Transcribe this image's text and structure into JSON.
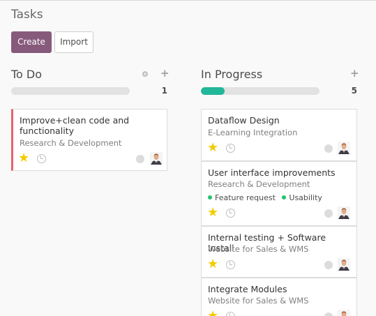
{
  "page": {
    "title": "Tasks"
  },
  "toolbar": {
    "create_label": "Create",
    "import_label": "Import"
  },
  "colors": {
    "accent": "#875a7b",
    "progress": "#21b799",
    "star": "#f3cc00",
    "tag_dot": "#21c56b",
    "priority_bar": "#e2646b"
  },
  "columns": [
    {
      "title": "To Do",
      "count": "1",
      "progress": 0,
      "icons": [
        "gear-icon",
        "plus-icon"
      ],
      "cards": [
        {
          "title": "Improve+clean code and functionality",
          "project": "Research & Development",
          "starred": true
        }
      ]
    },
    {
      "title": "In Progress",
      "count": "5",
      "progress": 0.2,
      "icons": [
        "plus-icon"
      ],
      "cards": [
        {
          "title": "Dataflow Design",
          "project": "E-Learning Integration",
          "starred": true
        },
        {
          "title": "User interface improvements",
          "project": "Research & Development",
          "tags": [
            "Feature request",
            "Usability"
          ],
          "starred": true
        },
        {
          "title": "Internal testing + Software Install",
          "project": "Website for Sales & WMS",
          "starred": true
        },
        {
          "title": "Integrate Modules",
          "project": "Website for Sales & WMS",
          "starred": true
        }
      ]
    }
  ]
}
